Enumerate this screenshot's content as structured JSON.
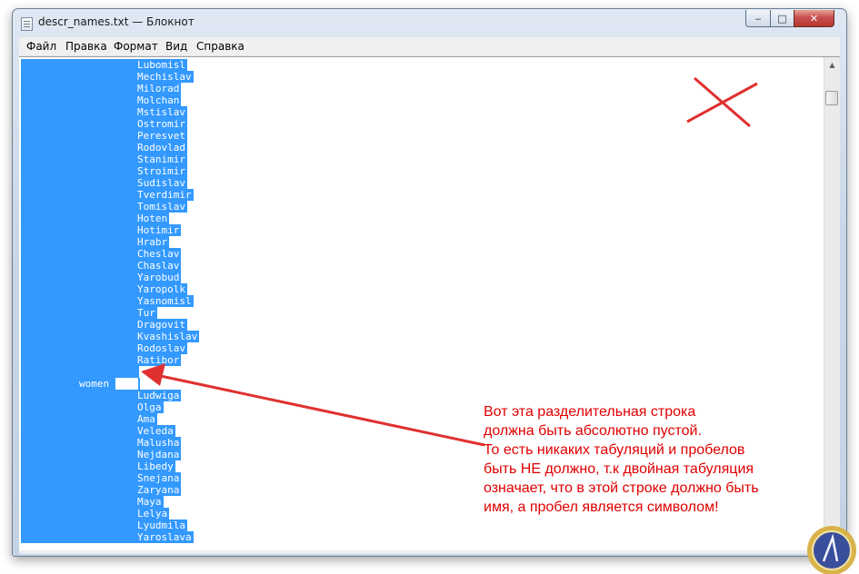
{
  "window": {
    "title": "descr_names.txt — Блокнот",
    "controls": {
      "minimize": "‒",
      "maximize": "□",
      "close": "✕"
    }
  },
  "menu": [
    {
      "label": "Файл"
    },
    {
      "label": "Правка"
    },
    {
      "label": "Формат"
    },
    {
      "label": "Вид"
    },
    {
      "label": "Справка"
    }
  ],
  "editor": {
    "selection_color": "#3399ff",
    "lines": [
      "Lubomisl",
      "Mechislav",
      "Milorad",
      "Molchan",
      "Mstislav",
      "Ostromir",
      "Peresvet",
      "Rodovlad",
      "Stanimir",
      "Stroimir",
      "Sudislav",
      "Tverdimir",
      "Tomislav",
      "Hoten",
      "Hotimir",
      "Hrabr",
      "Cheslav",
      "Chaslav",
      "Yarobud",
      "Yaropolk",
      "Yasnomisl",
      "Tur",
      "Dragovit",
      "Kvashislav",
      "Rodoslav",
      "Ratibor"
    ],
    "blank_line": "",
    "section_label": "women",
    "women_lines": [
      "Ludwiga",
      "Olga",
      "Ama",
      "Veleda",
      "Malusha",
      "Nejdana",
      "Libedy",
      "Snejana",
      "Zaryana",
      "Maya",
      "Lelya",
      "Lyudmila",
      "Yaroslava"
    ]
  },
  "annotation": {
    "color": "#e00000",
    "note_lines": [
      "Вот эта разделительная строка",
      "должна быть абсолютно пустой.",
      "То есть никаких табуляций и пробелов",
      "быть НЕ должно, т.к двойная табуляция",
      "означает, что в этой строке должно быть",
      "имя, а пробел является символом!"
    ]
  }
}
